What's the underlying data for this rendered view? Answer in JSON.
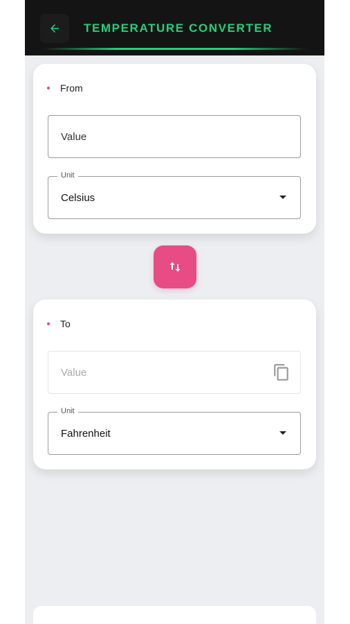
{
  "app": {
    "title": "TEMPERATURE CONVERTER"
  },
  "from": {
    "label": "From",
    "value_placeholder": "Value",
    "unit_label": "Unit",
    "unit_value": "Celsius"
  },
  "to": {
    "label": "To",
    "value_placeholder": "Value",
    "unit_label": "Unit",
    "unit_value": "Fahrenheit"
  },
  "icons": {
    "back": "arrow-left-icon",
    "swap": "swap-vertical-icon",
    "copy": "copy-icon",
    "dropdown": "chevron-down-icon"
  },
  "colors": {
    "accent": "#23d07a",
    "swap_button": "#e84c84",
    "appbar": "#141414"
  }
}
